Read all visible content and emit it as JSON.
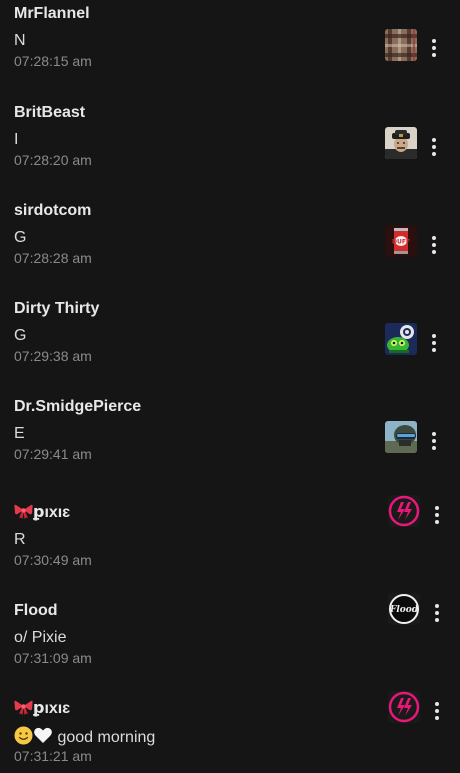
{
  "messages": [
    {
      "user": "MrFlannel",
      "text": "N",
      "time": "07:28:15 am",
      "avatar_icon": "flannel-avatar-icon"
    },
    {
      "user": "BritBeast",
      "text": "I",
      "time": "07:28:20 am",
      "avatar_icon": "officer-portrait-avatar-icon"
    },
    {
      "user": "sirdotcom",
      "text": "G",
      "time": "07:28:28 am",
      "avatar_icon": "duff-can-avatar-icon"
    },
    {
      "user": "Dirty Thirty",
      "text": "G",
      "time": "07:29:38 am",
      "avatar_icon": "green-creature-avatar-icon"
    },
    {
      "user": "Dr.SmidgePierce",
      "text": "E",
      "time": "07:29:41 am",
      "avatar_icon": "soldier-helmet-avatar-icon"
    },
    {
      "user": "ꝑıxıɛ",
      "user_prefix_icon": "ribbon-icon",
      "text": "R",
      "time": "07:30:49 am",
      "avatar_icon": "pink-lightning-avatar-icon"
    },
    {
      "user": "Flood",
      "text": "o/ Pixie",
      "time": "07:31:09 am",
      "avatar_icon": "flood-logo-avatar-icon"
    },
    {
      "user": "ꝑıxıɛ",
      "user_prefix_icon": "ribbon-icon",
      "text": "good morning",
      "text_prefix_icons": [
        "smiley-face-icon",
        "white-heart-icon"
      ],
      "time": "07:31:21 am",
      "avatar_icon": "pink-lightning-avatar-icon"
    }
  ],
  "menu_icon": "more-vertical-icon",
  "colors": {
    "background": "#151515",
    "username": "#e8e8e8",
    "text": "#dcdcdc",
    "timestamp": "#8a8a8a",
    "accent_pink": "#e8177a"
  }
}
